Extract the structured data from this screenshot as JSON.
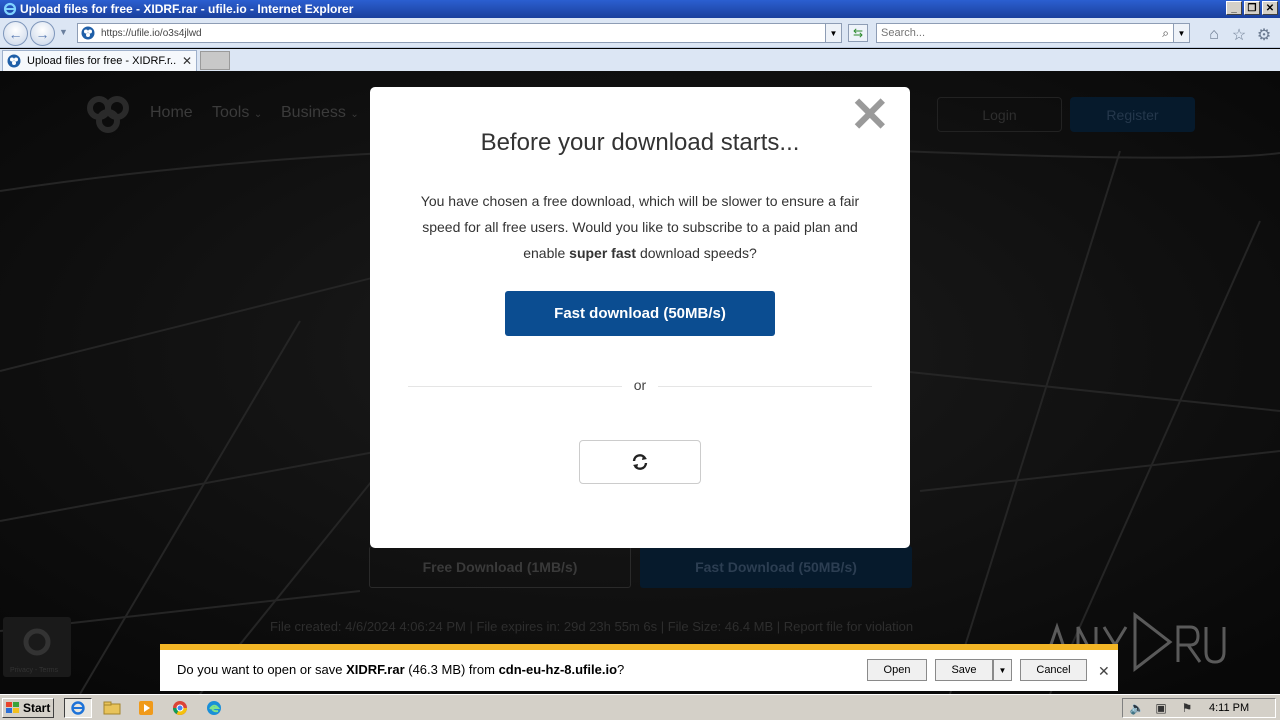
{
  "window": {
    "title": "Upload files for free - XIDRF.rar - ufile.io - Internet Explorer"
  },
  "address_bar": {
    "url": "https://ufile.io/o3s4jlwd",
    "search_placeholder": "Search..."
  },
  "tab": {
    "label": "Upload files for free - XIDRF.r..."
  },
  "site": {
    "nav": [
      "Home",
      "Tools",
      "Business"
    ],
    "login": "Login",
    "register": "Register",
    "free_download": "Free Download (1MB/s)",
    "fast_download": "Fast Download (50MB/s)",
    "file_info": "File created: 4/6/2024 4:06:24 PM   |   File expires in: 29d 23h 55m 6s   |   File Size: 46.4 MB   |   Report file for violation",
    "recaptcha_text": "Privacy - Terms"
  },
  "modal": {
    "title": "Before your download starts...",
    "body_pre": "You have chosen a free download, which will be slower to ensure a fair speed for all free users. Would you like to subscribe to a paid plan and enable ",
    "body_bold": "super fast",
    "body_post": " download speeds?",
    "fast_button": "Fast download (50MB/s)",
    "or": "or"
  },
  "download_bar": {
    "prefix": "Do you want to open or save ",
    "filename": "XIDRF.rar",
    "size": " (46.3 MB) from ",
    "host": "cdn-eu-hz-8.ufile.io",
    "suffix": "?",
    "open": "Open",
    "save": "Save",
    "cancel": "Cancel"
  },
  "taskbar": {
    "start": "Start",
    "clock": "4:11 PM"
  },
  "colors": {
    "modal_button": "#0b4d91",
    "download_bar_accent": "#f3b626"
  }
}
